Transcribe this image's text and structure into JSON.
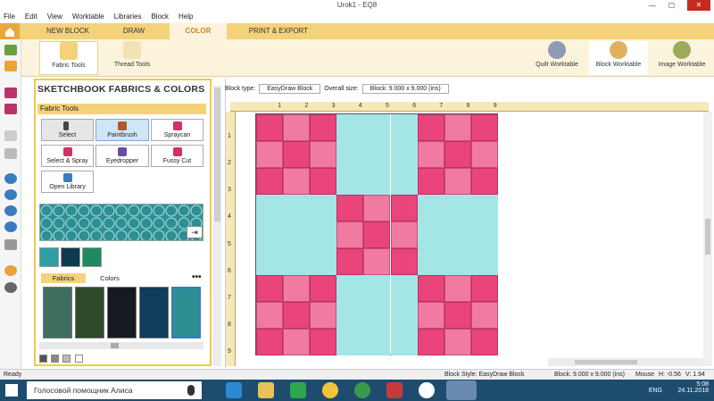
{
  "app": {
    "title": "Urok1 - EQ8"
  },
  "menu": [
    "File",
    "Edit",
    "View",
    "Worktable",
    "Libraries",
    "Block",
    "Help"
  ],
  "tabs": [
    "NEW BLOCK",
    "DRAW",
    "COLOR",
    "PRINT & EXPORT"
  ],
  "active_tab": "COLOR",
  "ribbon": {
    "left": [
      "Fabric Tools",
      "Thread Tools"
    ],
    "right": [
      "Quilt Worktable",
      "Block Worktable",
      "Image Worktable"
    ]
  },
  "palette": {
    "title": "SKETCHBOOK FABRICS & COLORS",
    "section": "Fabric Tools",
    "tools": [
      "Select",
      "Paintbrush",
      "Spraycan",
      "Select & Spray",
      "Eyedropper",
      "Fussy Cut",
      "Open Library"
    ],
    "subtabs": [
      "Fabrics",
      "Colors"
    ],
    "more": "•••"
  },
  "info": {
    "block_type_label": "Block type:",
    "block_type": "EasyDraw Block",
    "overall_label": "Overall size:",
    "overall": "Block: 9.000 x 9.000 (ins)"
  },
  "ruler": {
    "top": [
      "1",
      "2",
      "3",
      "4",
      "5",
      "6",
      "7",
      "8",
      "9"
    ],
    "left": [
      "1",
      "2",
      "3",
      "4",
      "5",
      "6",
      "7",
      "8",
      "9"
    ]
  },
  "status": {
    "ready": "Ready",
    "style": "Block Style: EasyDraw Block",
    "size": "Block: 9.000 x 9.000 (ins)",
    "mouse": "Mouse",
    "h": "H: -0.56",
    "v": "V: 1.94"
  },
  "taskbar": {
    "search": "Голосовой помощник Алиса",
    "lang": "ENG",
    "time": "5:08",
    "date": "24.11.2018"
  },
  "colors": {
    "accent": "#f3d27a",
    "pink": "#e9457b",
    "light_pink": "#f07aa0",
    "aqua": "#a4e6e6"
  }
}
